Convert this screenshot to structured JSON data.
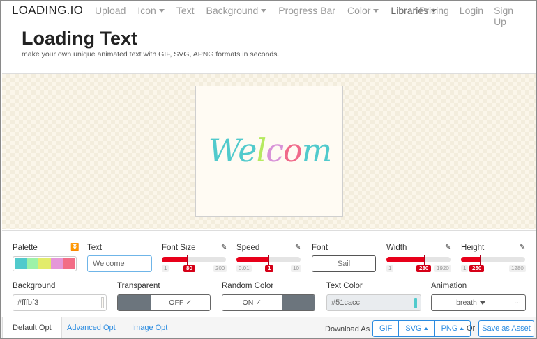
{
  "nav": {
    "brand": "LOADING.IO",
    "items": [
      {
        "label": "Upload",
        "caret": false
      },
      {
        "label": "Icon",
        "caret": true
      },
      {
        "label": "Text",
        "caret": false
      },
      {
        "label": "Background",
        "caret": true
      },
      {
        "label": "Progress Bar",
        "caret": false
      },
      {
        "label": "Color",
        "caret": true
      },
      {
        "label": "Libraries",
        "caret": true
      }
    ],
    "right": [
      "Pricing",
      "Login",
      "Sign Up"
    ]
  },
  "header": {
    "title": "Loading Text",
    "subtitle": "make your own unique animated text with GIF, SVG, APNG formats in seconds."
  },
  "preview": {
    "letters": [
      "W",
      "e",
      "l",
      "c",
      "o",
      "m"
    ],
    "letter_colors": [
      "#51cacc",
      "#51cacc",
      "#b5ea5f",
      "#d893d8",
      "#f06a8a",
      "#51cacc"
    ]
  },
  "controls": {
    "palette": {
      "label": "Palette",
      "colors": [
        "#51cacc",
        "#9df2a8",
        "#e2ec6b",
        "#e597d8",
        "#f26d86"
      ]
    },
    "text": {
      "label": "Text",
      "value": "Welcome"
    },
    "font_size": {
      "label": "Font Size",
      "min": "1",
      "value": "80",
      "max": "200",
      "fraction": 0.4
    },
    "speed": {
      "label": "Speed",
      "min": "0.01",
      "value": "1",
      "max": "10",
      "fraction": 0.5
    },
    "font": {
      "label": "Font",
      "value": "Sail"
    },
    "width": {
      "label": "Width",
      "min": "1",
      "value": "280",
      "max": "1920",
      "fraction": 0.6
    },
    "height": {
      "label": "Height",
      "min": "1",
      "value": "250",
      "max": "1280",
      "fraction": 0.3
    },
    "background": {
      "label": "Background",
      "value": "#fffbf3"
    },
    "transparent": {
      "label": "Transparent",
      "value": "OFF ✓"
    },
    "random_color": {
      "label": "Random Color",
      "value": "ON ✓"
    },
    "text_color": {
      "label": "Text Color",
      "value": "#51cacc"
    },
    "animation": {
      "label": "Animation",
      "value": "breath",
      "more": "..."
    }
  },
  "bottom": {
    "tabs": [
      "Default Opt",
      "Advanced Opt",
      "Image Opt"
    ],
    "download_label": "Download As",
    "formats": [
      "GIF",
      "SVG",
      "PNG"
    ],
    "or": "Or",
    "save_asset": "Save as Asset"
  }
}
